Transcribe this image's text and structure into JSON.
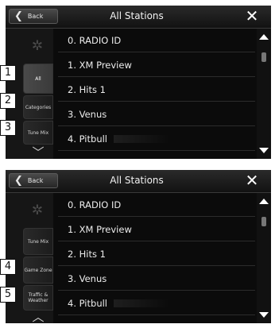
{
  "screens": [
    {
      "header": {
        "back_label": "Back",
        "title": "All Stations",
        "close_icon": "close-icon"
      },
      "side": {
        "gear_icon": "gear-icon",
        "items": [
          {
            "label": "All",
            "active": true
          },
          {
            "label": "Categories",
            "active": false
          },
          {
            "label": "Tune Mix",
            "active": false
          }
        ],
        "scroll_icon": "chevron-down-icon"
      },
      "stations": [
        "0. RADIO ID",
        "1. XM Preview",
        "2. Hits 1",
        "3. Venus",
        "4. Pitbull"
      ],
      "callouts": [
        "1",
        "2",
        "3"
      ]
    },
    {
      "header": {
        "back_label": "Back",
        "title": "All Stations",
        "close_icon": "close-icon"
      },
      "side": {
        "gear_icon": "gear-icon",
        "items": [
          {
            "label": "Tune Mix",
            "active": false
          },
          {
            "label": "Game Zone",
            "active": false
          },
          {
            "label": "Traffic & Weather",
            "active": false
          }
        ],
        "scroll_icon": "chevron-up-icon"
      },
      "stations": [
        "0. RADIO ID",
        "1. XM Preview",
        "2. Hits 1",
        "3. Venus",
        "4. Pitbull"
      ],
      "callouts": [
        "4",
        "5"
      ]
    }
  ]
}
